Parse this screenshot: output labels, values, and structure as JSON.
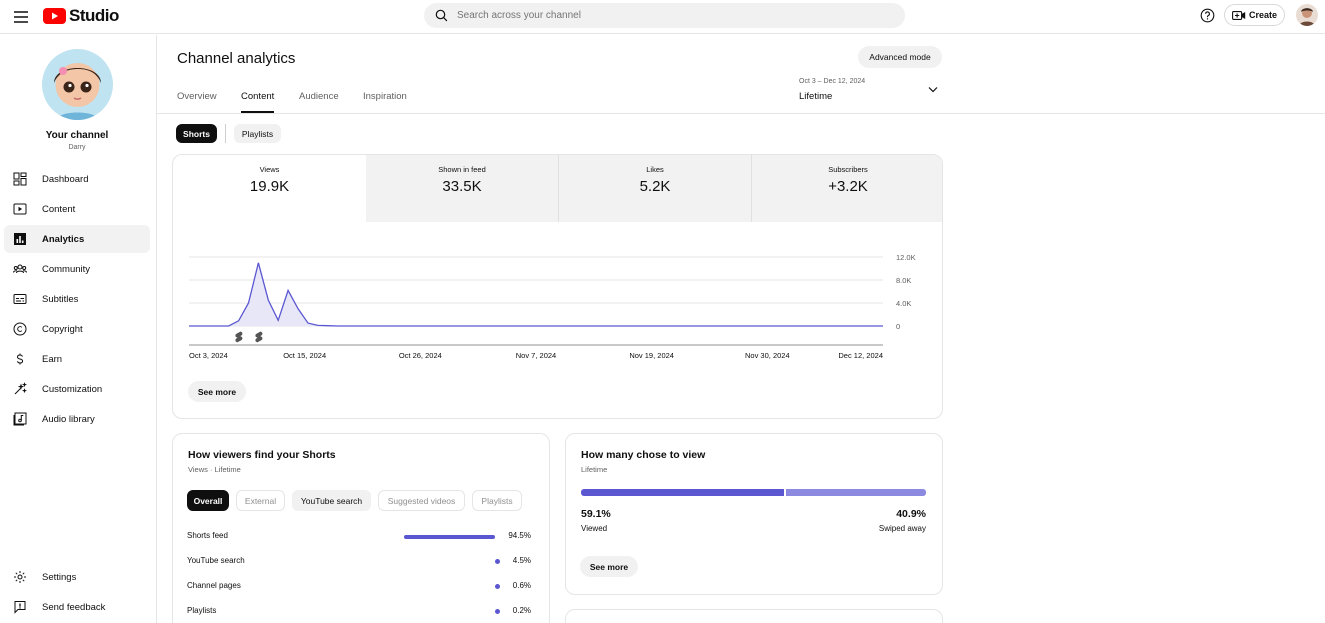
{
  "header": {
    "app_name": "Studio",
    "search_placeholder": "Search across your channel",
    "create_label": "Create"
  },
  "sidebar": {
    "channel_title": "Your channel",
    "channel_handle": "Darry",
    "items": [
      {
        "label": "Dashboard",
        "icon": "dashboard-icon"
      },
      {
        "label": "Content",
        "icon": "content-icon"
      },
      {
        "label": "Analytics",
        "icon": "analytics-icon",
        "active": true
      },
      {
        "label": "Community",
        "icon": "community-icon"
      },
      {
        "label": "Subtitles",
        "icon": "subtitles-icon"
      },
      {
        "label": "Copyright",
        "icon": "copyright-icon"
      },
      {
        "label": "Earn",
        "icon": "earn-icon"
      },
      {
        "label": "Customization",
        "icon": "customization-icon"
      },
      {
        "label": "Audio library",
        "icon": "audio-library-icon"
      }
    ],
    "footer": [
      {
        "label": "Settings",
        "icon": "settings-icon"
      },
      {
        "label": "Send feedback",
        "icon": "feedback-icon"
      }
    ]
  },
  "main": {
    "title": "Channel analytics",
    "advanced_mode_label": "Advanced mode",
    "tabs": [
      {
        "label": "Overview"
      },
      {
        "label": "Content",
        "active": true
      },
      {
        "label": "Audience"
      },
      {
        "label": "Inspiration"
      }
    ],
    "date_range": {
      "dates": "Oct 3 – Dec 12, 2024",
      "period": "Lifetime"
    },
    "content_chips": [
      {
        "label": "Shorts",
        "selected": true
      },
      {
        "label": "Playlists"
      }
    ],
    "metrics": [
      {
        "label": "Views",
        "value": "19.9K",
        "selected": true
      },
      {
        "label": "Shown in feed",
        "value": "33.5K"
      },
      {
        "label": "Likes",
        "value": "5.2K"
      },
      {
        "label": "Subscribers",
        "value": "+3.2K"
      }
    ],
    "see_more_label": "See more"
  },
  "chart_data": {
    "type": "line",
    "series": [
      {
        "values": [
          0,
          0,
          0,
          0,
          0,
          900,
          4000,
          11000,
          4500,
          1000,
          6200,
          3000,
          500,
          100,
          50,
          0,
          0,
          0,
          0,
          0,
          0,
          0,
          0,
          0,
          0,
          0,
          0,
          0,
          0,
          0,
          0,
          0,
          0,
          0,
          0,
          0,
          0,
          0,
          0,
          0,
          0,
          0,
          0,
          0,
          0,
          0,
          0,
          0,
          0,
          0,
          0,
          0,
          0,
          0,
          0,
          0,
          0,
          0,
          0,
          0,
          0,
          0,
          0,
          0,
          0,
          0,
          0,
          0,
          0,
          0,
          0
        ]
      }
    ],
    "x_tick_labels": [
      "Oct 3, 2024",
      "Oct 15, 2024",
      "Oct 26, 2024",
      "Nov 7, 2024",
      "Nov 19, 2024",
      "Nov 30, 2024",
      "Dec 12, 2024"
    ],
    "y_tick_labels": [
      "12.0K",
      "8.0K",
      "4.0K",
      "0"
    ],
    "ylim": [
      0,
      12000
    ],
    "y_axis_position": "right",
    "grid": true,
    "fill": "area under line",
    "color": "#5b57d1",
    "markers": [
      "shorts-icon",
      "shorts-icon"
    ]
  },
  "discovery": {
    "title": "How viewers find your Shorts",
    "subtitle": "Views · Lifetime",
    "filters": [
      {
        "label": "Overall",
        "state": "selected"
      },
      {
        "label": "External",
        "state": "disabled"
      },
      {
        "label": "YouTube search",
        "state": "hover"
      },
      {
        "label": "Suggested videos",
        "state": "disabled"
      },
      {
        "label": "Playlists",
        "state": "disabled"
      }
    ],
    "sources": [
      {
        "label": "Shorts feed",
        "percent": "94.5%",
        "value": 94.5
      },
      {
        "label": "YouTube search",
        "percent": "4.5%",
        "value": 4.5
      },
      {
        "label": "Channel pages",
        "percent": "0.6%",
        "value": 0.6
      },
      {
        "label": "Playlists",
        "percent": "0.2%",
        "value": 0.2
      }
    ]
  },
  "viewed": {
    "title": "How many chose to view",
    "subtitle": "Lifetime",
    "viewed_percent": "59.1%",
    "viewed_label": "Viewed",
    "viewed_value": 59.1,
    "swiped_percent": "40.9%",
    "swiped_label": "Swiped away",
    "swiped_value": 40.9,
    "colors": {
      "viewed": "#5b57d1",
      "swiped": "#8c89e0"
    },
    "see_more_label": "See more"
  },
  "colors": {
    "accent": "#5b57d1",
    "brand_red": "#ff0000"
  }
}
